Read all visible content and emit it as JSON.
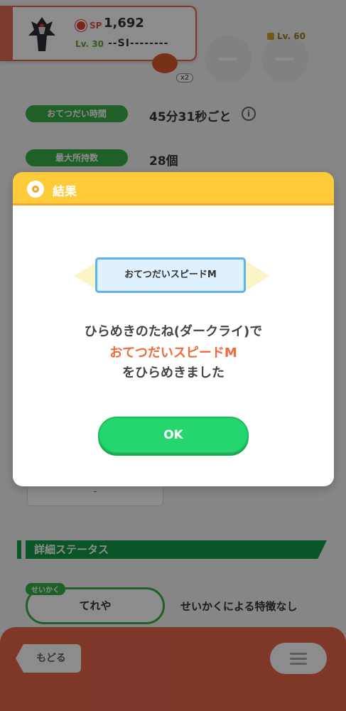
{
  "background": {
    "pokemon_card": {
      "sp_label": "SP",
      "sp_value": "1,692",
      "level": "Lv. 30",
      "sub_skill_slot": "--SI--------"
    },
    "ingredient_multiplier": "x2",
    "locked_slot_level": "Lv. 60",
    "rows": [
      {
        "label": "おてつだい時間",
        "value": "45分31秒ごと"
      },
      {
        "label": "最大所持数",
        "value": "28個"
      }
    ],
    "info_glyph": "i",
    "dash_value": "-",
    "section_title": "詳細ステータス",
    "nature": {
      "tag": "せいかく",
      "value": "てれや",
      "note": "せいかくによる特徴なし"
    },
    "back_label": "もどる"
  },
  "dialog": {
    "title": "結果",
    "skill_name": "おてつだいスピードM",
    "message_line1": "ひらめきのたね(ダークライ)で",
    "message_line2": "おてつだいスピードM",
    "message_line3": "をひらめきました",
    "ok_label": "OK"
  },
  "colors": {
    "header_yellow": "#ffcb3a",
    "ok_green": "#25d56e",
    "highlight_orange": "#f06a3a",
    "bottom_bar": "#e8654a",
    "pill_green": "#3ab04a"
  },
  "icons": [
    "pokeball-icon",
    "sp-icon",
    "lock-icon",
    "info-icon",
    "menu-icon",
    "back-arrow-icon"
  ]
}
